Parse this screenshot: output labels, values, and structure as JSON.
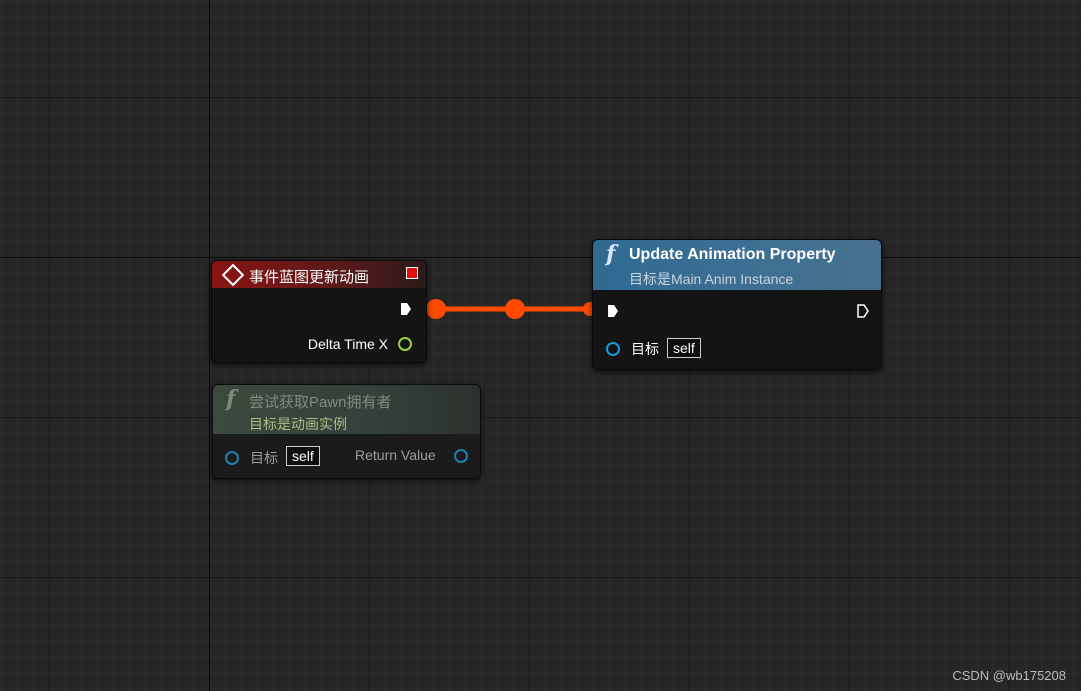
{
  "canvas": {
    "background": "#262626"
  },
  "event_node": {
    "title": "事件蓝图更新动画",
    "header_color": "#8a1414",
    "output_pin_label": "Delta Time X"
  },
  "function_node": {
    "title": "Update Animation Property",
    "subtitle": "目标是Main Anim Instance",
    "header_color": "#3c6f93",
    "target_label": "目标",
    "target_value": "self"
  },
  "pure_node": {
    "title": "尝试获取Pawn拥有者",
    "subtitle": "目标是动画实例",
    "header_color": "#3b4a3d",
    "target_label": "目标",
    "target_value": "self",
    "return_label": "Return Value"
  },
  "wire": {
    "color": "#ff4a00"
  },
  "watermark": "CSDN @wb175208"
}
